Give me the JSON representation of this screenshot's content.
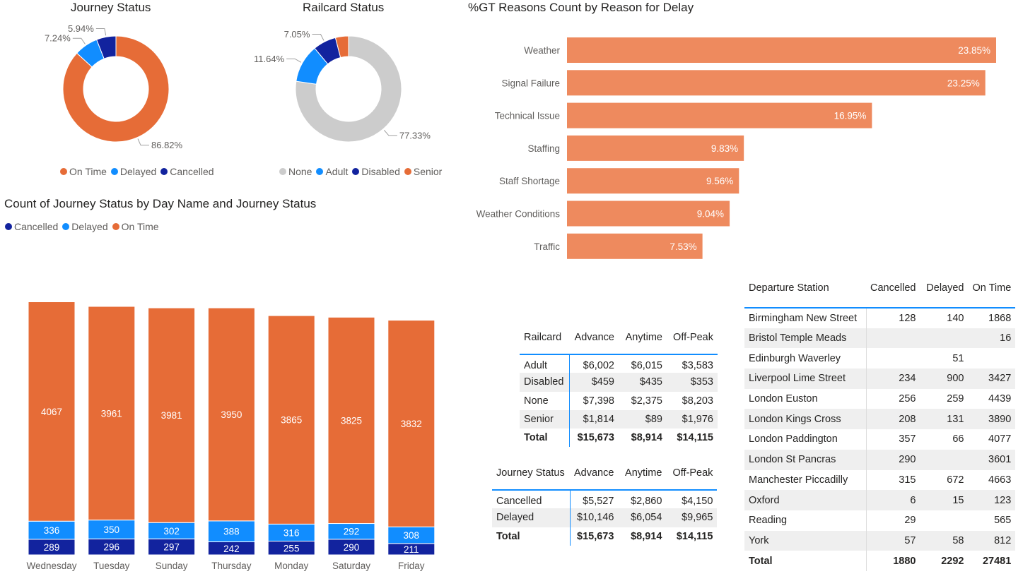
{
  "colors": {
    "on_time": "#E66C37",
    "delayed": "#118DFF",
    "cancelled": "#12239E",
    "none": "#CCCCCC",
    "adult": "#118DFF",
    "disabled": "#12239E",
    "senior": "#E66C37",
    "bar": "#EE8A5E"
  },
  "journey_status_donut": {
    "title": "Journey Status",
    "legend": [
      "On Time",
      "Delayed",
      "Cancelled"
    ]
  },
  "railcard_donut": {
    "title": "Railcard Status",
    "legend": [
      "None",
      "Adult",
      "Disabled",
      "Senior"
    ]
  },
  "reasons_bar": {
    "title": "%GT Reasons Count by Reason for Delay"
  },
  "day_chart": {
    "title": "Count of Journey Status by Day Name and Journey Status",
    "legend": [
      "Cancelled",
      "Delayed",
      "On Time"
    ]
  },
  "chart_data": [
    {
      "type": "pie",
      "title": "Journey Status",
      "categories": [
        "On Time",
        "Delayed",
        "Cancelled"
      ],
      "values": [
        86.82,
        7.24,
        5.94
      ],
      "labels": [
        "86.82%",
        "7.24%",
        "5.94%"
      ]
    },
    {
      "type": "pie",
      "title": "Railcard Status",
      "categories": [
        "None",
        "Adult",
        "Disabled",
        "Senior"
      ],
      "values": [
        77.33,
        11.64,
        7.05,
        3.98
      ],
      "labels": [
        "77.33%",
        "11.64%",
        "7.05%",
        ""
      ]
    },
    {
      "type": "bar",
      "title": "%GT Reasons Count by Reason for Delay",
      "categories": [
        "Weather",
        "Signal Failure",
        "Technical Issue",
        "Staffing",
        "Staff Shortage",
        "Weather Conditions",
        "Traffic"
      ],
      "values": [
        23.85,
        23.25,
        16.95,
        9.83,
        9.56,
        9.04,
        7.53
      ],
      "labels": [
        "23.85%",
        "23.25%",
        "16.95%",
        "9.83%",
        "9.56%",
        "9.04%",
        "7.53%"
      ],
      "xlim": [
        0,
        25
      ]
    },
    {
      "type": "bar",
      "title": "Count of Journey Status by Day Name and Journey Status",
      "categories": [
        "Wednesday",
        "Tuesday",
        "Sunday",
        "Thursday",
        "Monday",
        "Saturday",
        "Friday"
      ],
      "series": [
        {
          "name": "Cancelled",
          "values": [
            289,
            296,
            297,
            242,
            255,
            290,
            211
          ]
        },
        {
          "name": "Delayed",
          "values": [
            336,
            350,
            302,
            388,
            316,
            292,
            308
          ]
        },
        {
          "name": "On Time",
          "values": [
            4067,
            3961,
            3981,
            3950,
            3865,
            3825,
            3832
          ]
        }
      ],
      "stacked": true,
      "legend": "top-left"
    },
    {
      "type": "table",
      "columns": [
        "Railcard",
        "Advance",
        "Anytime",
        "Off-Peak"
      ],
      "rows": [
        [
          "Adult",
          "$6,002",
          "$6,015",
          "$3,583"
        ],
        [
          "Disabled",
          "$459",
          "$435",
          "$353"
        ],
        [
          "None",
          "$7,398",
          "$2,375",
          "$8,203"
        ],
        [
          "Senior",
          "$1,814",
          "$89",
          "$1,976"
        ]
      ],
      "total": [
        "Total",
        "$15,673",
        "$8,914",
        "$14,115"
      ]
    },
    {
      "type": "table",
      "columns": [
        "Journey Status",
        "Advance",
        "Anytime",
        "Off-Peak"
      ],
      "rows": [
        [
          "Cancelled",
          "$5,527",
          "$2,860",
          "$4,150"
        ],
        [
          "Delayed",
          "$10,146",
          "$6,054",
          "$9,965"
        ]
      ],
      "total": [
        "Total",
        "$15,673",
        "$8,914",
        "$14,115"
      ]
    },
    {
      "type": "table",
      "columns": [
        "Departure Station",
        "Cancelled",
        "Delayed",
        "On Time"
      ],
      "rows": [
        [
          "Birmingham New Street",
          "128",
          "140",
          "1868"
        ],
        [
          "Bristol Temple Meads",
          "",
          "",
          "16"
        ],
        [
          "Edinburgh Waverley",
          "",
          "51",
          ""
        ],
        [
          "Liverpool Lime Street",
          "234",
          "900",
          "3427"
        ],
        [
          "London Euston",
          "256",
          "259",
          "4439"
        ],
        [
          "London Kings Cross",
          "208",
          "131",
          "3890"
        ],
        [
          "London Paddington",
          "357",
          "66",
          "4077"
        ],
        [
          "London St Pancras",
          "290",
          "",
          "3601"
        ],
        [
          "Manchester Piccadilly",
          "315",
          "672",
          "4663"
        ],
        [
          "Oxford",
          "6",
          "15",
          "123"
        ],
        [
          "Reading",
          "29",
          "",
          "565"
        ],
        [
          "York",
          "57",
          "58",
          "812"
        ]
      ],
      "total": [
        "Total",
        "1880",
        "2292",
        "27481"
      ]
    }
  ]
}
